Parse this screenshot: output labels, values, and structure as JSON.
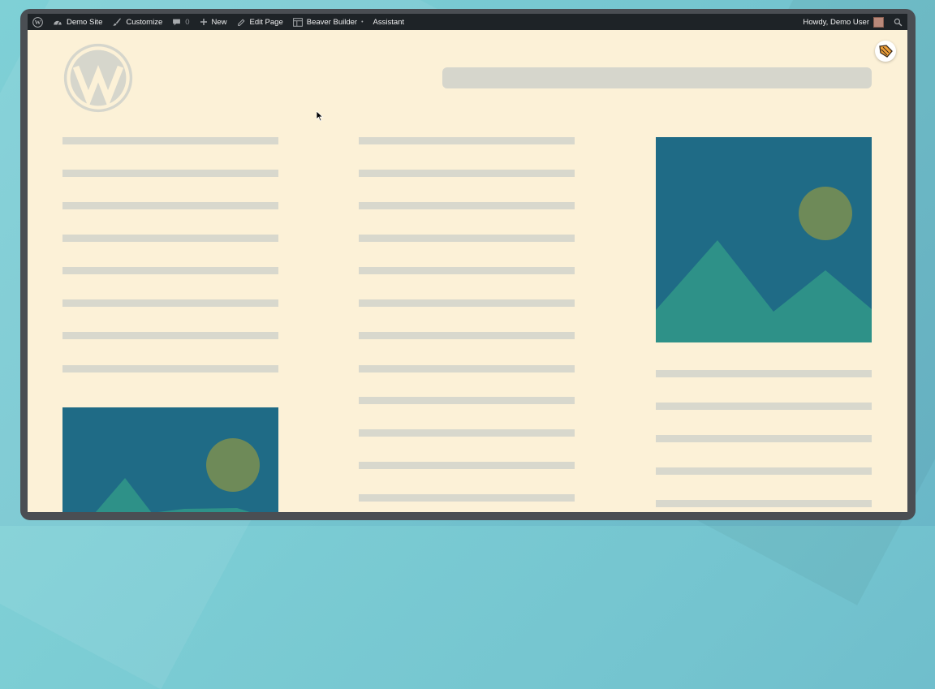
{
  "adminbar": {
    "site_label": "Demo Site",
    "customize_label": "Customize",
    "comments_count": "0",
    "new_label": "New",
    "edit_label": "Edit Page",
    "builder_label": "Beaver Builder",
    "builder_caret": "•",
    "assistant_label": "Assistant",
    "howdy_label": "Howdy, Demo User"
  },
  "icons": {
    "wp_logo": "wordpress-icon",
    "dashboard": "dashboard-icon",
    "customize": "brush-icon",
    "comments": "comment-icon",
    "new": "plus-icon",
    "edit": "pencil-icon",
    "builder": "layout-icon",
    "search": "search-icon",
    "beaver": "beaver-builder-icon"
  },
  "colors": {
    "adminbar_bg": "#1e2327",
    "page_bg": "#fcf1d7",
    "placeholder_line": "#d8d8cd",
    "image_sky": "#1f6b86",
    "image_mountain": "#2e9188",
    "image_sun": "#6e8a58"
  }
}
